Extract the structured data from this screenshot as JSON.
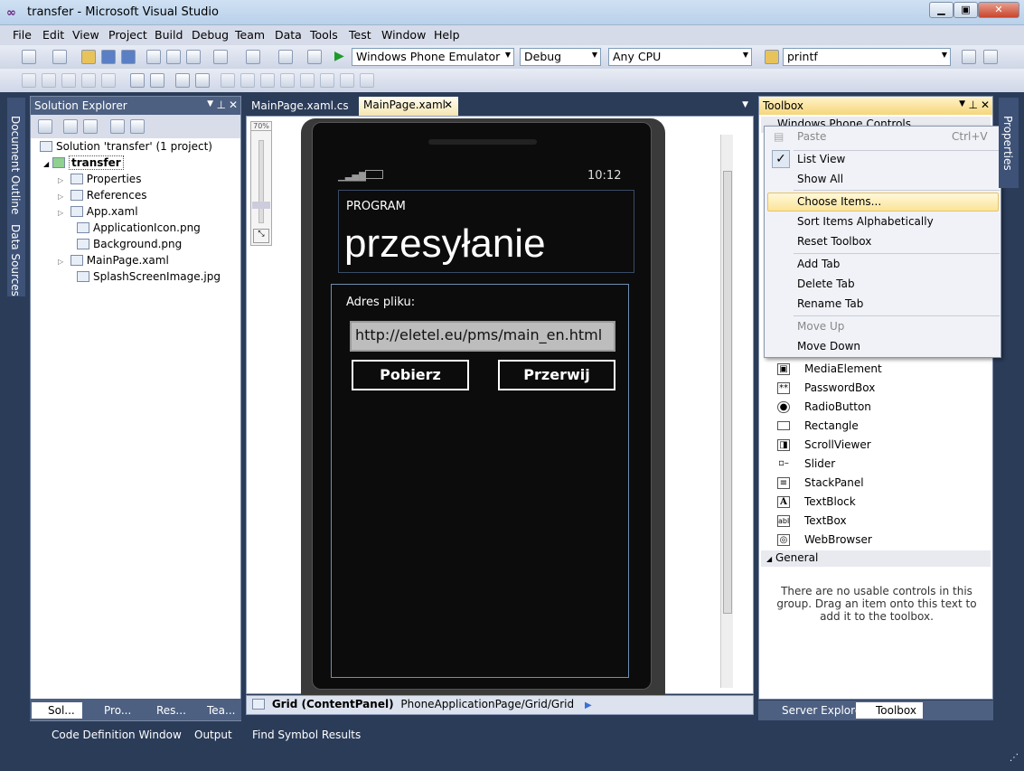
{
  "window": {
    "title": "transfer - Microsoft Visual Studio"
  },
  "menu": [
    "File",
    "Edit",
    "View",
    "Project",
    "Build",
    "Debug",
    "Team",
    "Data",
    "Tools",
    "Test",
    "Window",
    "Help"
  ],
  "toolbar": {
    "target_device": "Windows Phone Emulator",
    "configuration": "Debug",
    "platform": "Any CPU",
    "find_text": "printf"
  },
  "left_side_tabs": {
    "document_outline": "Document Outline",
    "data_sources": "Data Sources"
  },
  "right_side_tabs": {
    "properties": "Properties"
  },
  "solution_explorer": {
    "title": "Solution Explorer",
    "solution": "Solution 'transfer' (1 project)",
    "project": "transfer",
    "items": [
      "Properties",
      "References",
      "App.xaml",
      "ApplicationIcon.png",
      "Background.png",
      "MainPage.xaml",
      "SplashScreenImage.jpg"
    ],
    "bottom_tabs": [
      "Sol...",
      "Pro...",
      "Res...",
      "Tea..."
    ]
  },
  "editor": {
    "tabs": [
      "MainPage.xaml.cs",
      "MainPage.xaml"
    ],
    "zoom": "70%",
    "breadcrumb_label": "Grid (ContentPanel)",
    "breadcrumb_path": "PhoneApplicationPage/Grid/Grid"
  },
  "phone": {
    "time": "10:12",
    "app_title": "PROGRAM",
    "page_title": "przesyłanie",
    "address_label": "Adres pliku:",
    "url_value": "http://eletel.eu/pms/main_en.html",
    "download_button": "Pobierz",
    "abort_button": "Przerwij"
  },
  "toolbox": {
    "title": "Toolbox",
    "group_header": "Windows Phone Controls",
    "context_menu": [
      {
        "label": "Paste",
        "shortcut": "Ctrl+V",
        "disabled": true
      },
      {
        "label": "List View",
        "checked": true
      },
      {
        "label": "Show All"
      },
      {
        "label": "Choose Items...",
        "highlighted": true
      },
      {
        "label": "Sort Items Alphabetically"
      },
      {
        "label": "Reset Toolbox"
      },
      {
        "label": "Add Tab"
      },
      {
        "label": "Delete Tab"
      },
      {
        "label": "Rename Tab"
      },
      {
        "label": "Move Up",
        "disabled": true
      },
      {
        "label": "Move Down"
      }
    ],
    "items": [
      {
        "label": "MediaElement",
        "icon": "media-icon"
      },
      {
        "label": "PasswordBox",
        "icon": "password-icon"
      },
      {
        "label": "RadioButton",
        "icon": "radio-icon"
      },
      {
        "label": "Rectangle",
        "icon": "rectangle-icon"
      },
      {
        "label": "ScrollViewer",
        "icon": "scroll-icon"
      },
      {
        "label": "Slider",
        "icon": "slider-icon"
      },
      {
        "label": "StackPanel",
        "icon": "stackpanel-icon"
      },
      {
        "label": "TextBlock",
        "icon": "textblock-icon"
      },
      {
        "label": "TextBox",
        "icon": "textbox-icon"
      },
      {
        "label": "WebBrowser",
        "icon": "web-icon"
      }
    ],
    "general_header": "General",
    "general_empty": "There are no usable controls in this group. Drag an item onto this text to add it to the toolbox.",
    "bottom_tabs": [
      "Server Explorer",
      "Toolbox"
    ]
  },
  "bottom_tabs": [
    "Code Definition Window",
    "Output",
    "Find Symbol Results"
  ]
}
